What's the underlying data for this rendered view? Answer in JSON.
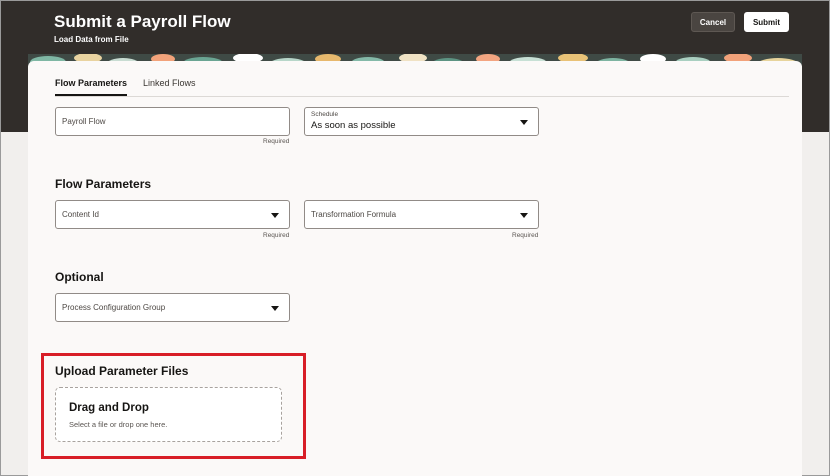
{
  "header": {
    "title": "Submit a Payroll Flow",
    "subtitle": "Load Data from File",
    "cancel_label": "Cancel",
    "submit_label": "Submit"
  },
  "tabs": [
    {
      "label": "Flow Parameters",
      "active": true
    },
    {
      "label": "Linked Flows",
      "active": false
    }
  ],
  "top_fields": {
    "payroll_flow": {
      "label": "Payroll Flow",
      "required": "Required"
    },
    "schedule": {
      "label": "Schedule",
      "value": "As soon as possible"
    }
  },
  "flow_parameters": {
    "heading": "Flow Parameters",
    "content_id": {
      "label": "Content Id",
      "required": "Required"
    },
    "transformation_formula": {
      "label": "Transformation Formula",
      "required": "Required"
    }
  },
  "optional": {
    "heading": "Optional",
    "process_configuration_group": {
      "label": "Process Configuration Group"
    }
  },
  "upload": {
    "heading": "Upload Parameter Files",
    "title": "Drag and Drop",
    "subtitle": "Select a file or drop one here."
  },
  "colors": {
    "header_bg": "#312d2a",
    "highlight": "#d81e27",
    "panel_bg": "#fbf9f8"
  }
}
